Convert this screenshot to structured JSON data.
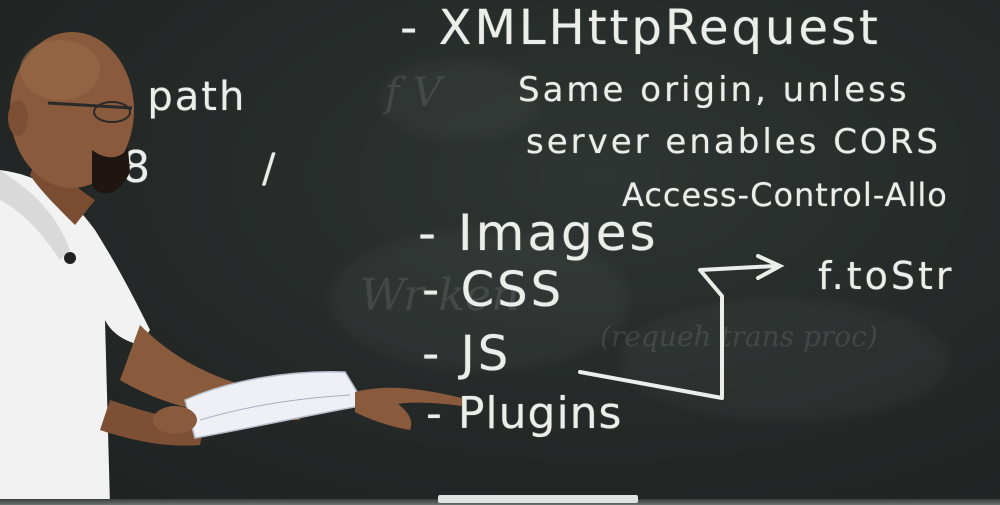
{
  "board": {
    "title_line": "- XMLHttpRequest",
    "note_line_1": "Same origin, unless",
    "note_line_2": "server enables CORS",
    "header_line": "Access-Control-Allo",
    "list": [
      "- Images",
      "- CSS",
      "- JS",
      "- Plugins"
    ],
    "arrow_target": "f.toStr",
    "left_fragment_1": "t path",
    "left_fragment_2": "8",
    "left_fragment_3": "/"
  },
  "colors": {
    "chalkboard": "#262b2a",
    "chalk": "#ecefe9",
    "shirt": "#f2f2f2",
    "skin": "#8a5a3c"
  }
}
